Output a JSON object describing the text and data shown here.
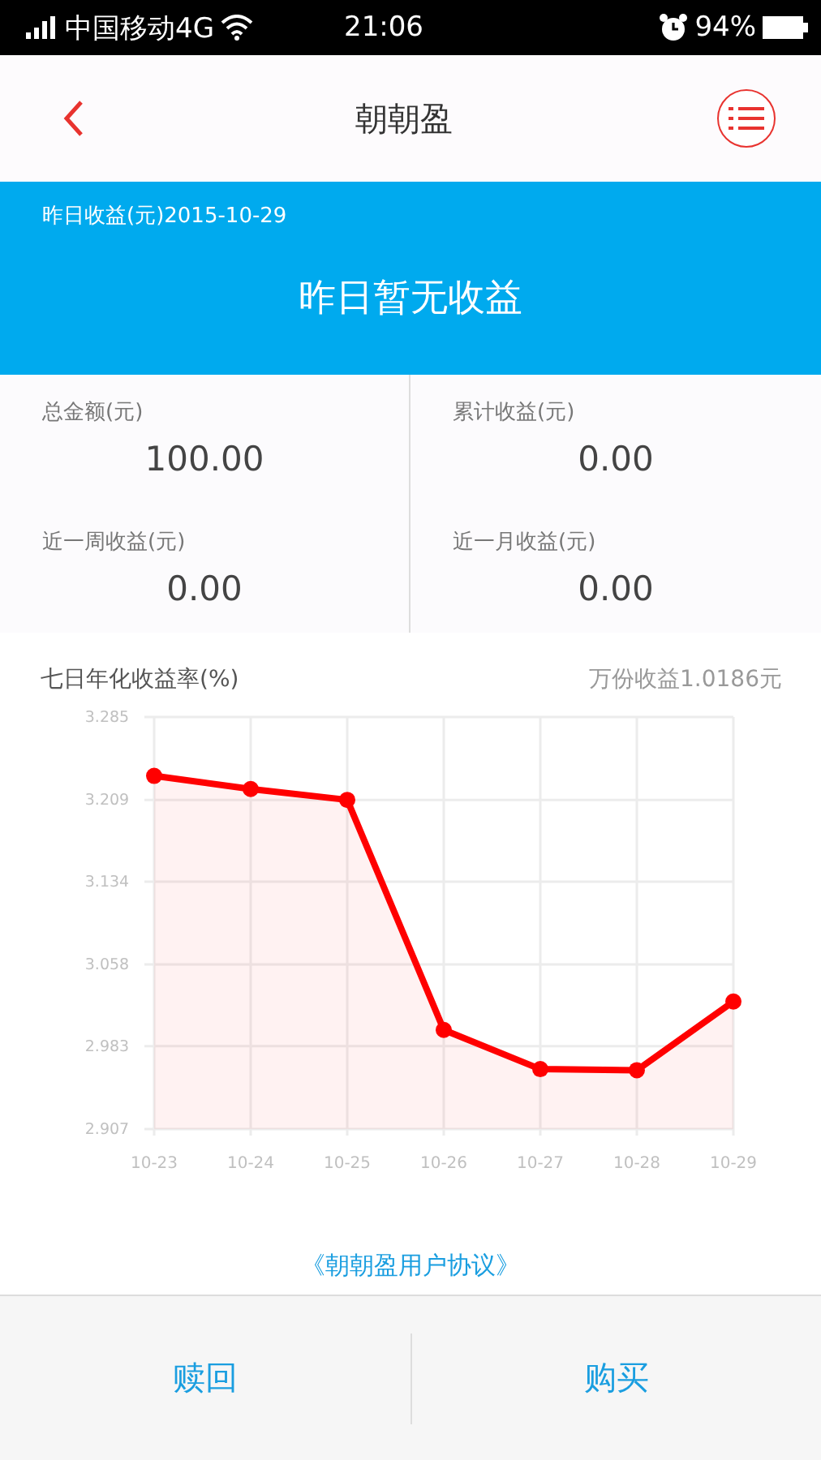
{
  "status_bar": {
    "carrier": "中国移动4G",
    "time": "21:06",
    "battery": "94%"
  },
  "header": {
    "title": "朝朝盈"
  },
  "banner": {
    "label": "昨日收益(元)2015-10-29",
    "message": "昨日暂无收益"
  },
  "stats": [
    {
      "label": "总金额(元)",
      "value": "100.00"
    },
    {
      "label": "累计收益(元)",
      "value": "0.00"
    },
    {
      "label": "近一周收益(元)",
      "value": "0.00"
    },
    {
      "label": "近一月收益(元)",
      "value": "0.00"
    }
  ],
  "chart": {
    "title": "七日年化收益率(%)",
    "side_note": "万份收益1.0186元",
    "chart_data": {
      "type": "area",
      "categories": [
        "10-23",
        "10-24",
        "10-25",
        "10-26",
        "10-27",
        "10-28",
        "10-29"
      ],
      "grid": true,
      "series": [
        {
          "color": "#ff0000",
          "values": [
            3.231,
            3.219,
            3.209,
            2.998,
            2.962,
            2.961,
            3.024
          ]
        }
      ],
      "ylim": [
        2.907,
        3.285
      ],
      "yticks": [
        {
          "value": 2.907,
          "label": "2.907"
        },
        {
          "value": 2.983,
          "label": "2.983"
        },
        {
          "value": 3.058,
          "label": "3.058"
        },
        {
          "value": 3.134,
          "label": "3.134"
        },
        {
          "value": 3.209,
          "label": "3.209"
        },
        {
          "value": 3.285,
          "label": "3.285"
        }
      ]
    }
  },
  "agreement_link": "《朝朝盈用户协议》",
  "actions": [
    "赎回",
    "购买"
  ]
}
